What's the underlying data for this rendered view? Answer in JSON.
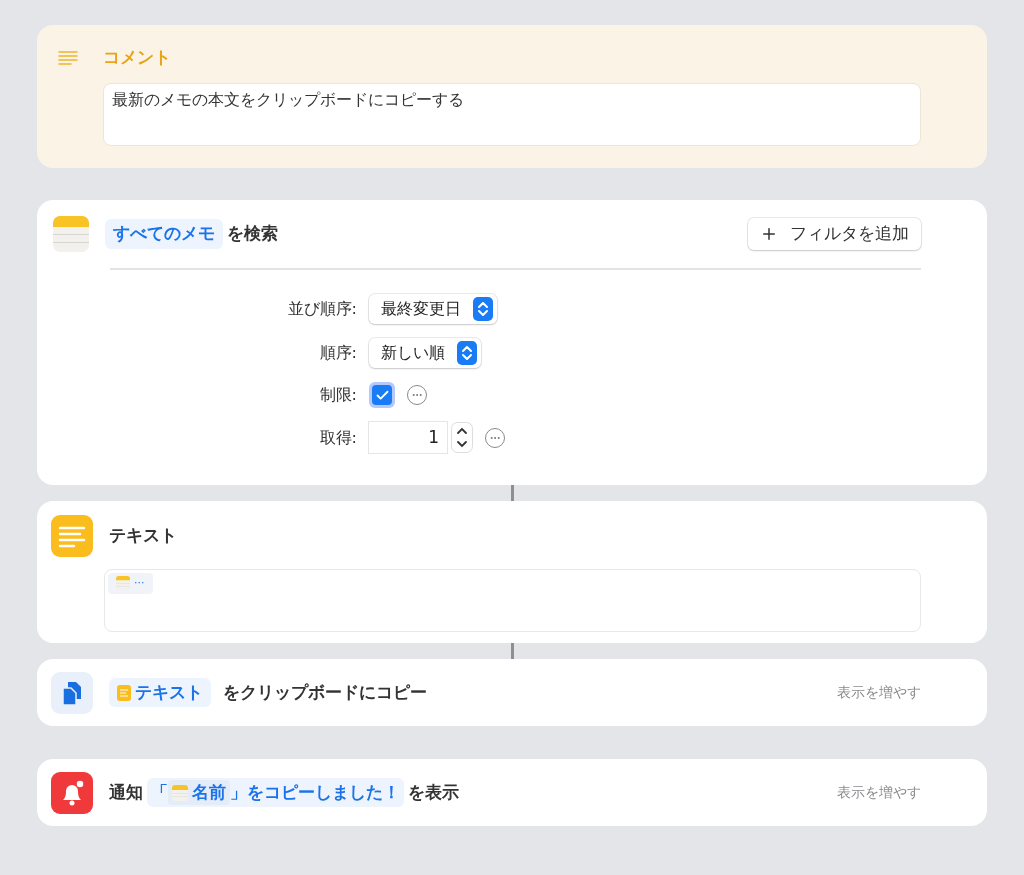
{
  "comment": {
    "title": "コメント",
    "text": "最新のメモの本文をクリップボードにコピーする"
  },
  "find": {
    "scope": "すべてのメモ",
    "verb": "を検索",
    "filter_button": "フィルタを追加",
    "options": [
      {
        "kind": "select",
        "label": "並び順序:",
        "value": "最終変更日"
      },
      {
        "kind": "select",
        "label": "順序:",
        "value": "新しい順"
      },
      {
        "kind": "checkbox",
        "label": "制限:",
        "checked": true
      },
      {
        "kind": "stepper",
        "label": "取得:",
        "value": "1"
      }
    ]
  },
  "text_action": {
    "title": "テキスト",
    "token": "···"
  },
  "copy_action": {
    "token": "テキスト",
    "verb": "をクリップボードにコピー",
    "more": "表示を増やす"
  },
  "notify_action": {
    "prefix": "通知",
    "open_quote": "「",
    "token": "名前",
    "rest": "」をコピーしました！",
    "suffix": "を表示",
    "more": "表示を増やす"
  }
}
